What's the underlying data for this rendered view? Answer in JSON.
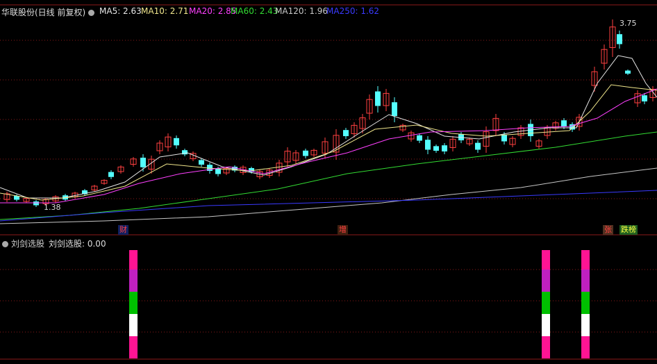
{
  "stock": {
    "title": "华联股份(日线 前复权)"
  },
  "ma_legend": [
    {
      "label": "MA5: 2.63",
      "color": "#e6e6e6"
    },
    {
      "label": "MA10: 2.71",
      "color": "#f0e68c"
    },
    {
      "label": "MA20: 2.85",
      "color": "#ff40ff"
    },
    {
      "label": "MA60: 2.43",
      "color": "#33dd33"
    },
    {
      "label": "MA120: 1.96",
      "color": "#c8c8c8"
    },
    {
      "label": "MA250: 1.62",
      "color": "#3a3aff"
    }
  ],
  "price_high_label": "3.75",
  "price_low_label": "1.38",
  "tags": {
    "cai": "财",
    "zeng": "增",
    "zhang": "张",
    "dieban": "跌榜"
  },
  "indicator": {
    "name": "刘剑选股",
    "value_text": "刘剑选股: 0.00"
  },
  "colors": {
    "up": "#ff4040",
    "down": "#54ffff",
    "grid": "#8b1a1a",
    "bar_pink": "#ff1493",
    "bar_magenta": "#c020c0",
    "bar_green": "#00c000",
    "bar_white": "#ffffff"
  }
}
